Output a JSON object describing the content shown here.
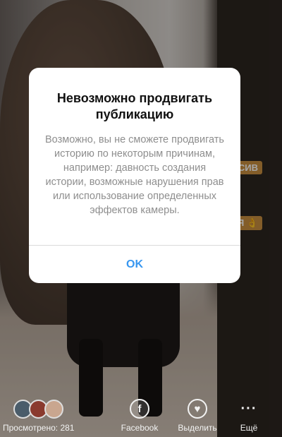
{
  "background": {
    "stickers": [
      "ТНСИВ",
      "ОСЯ 👌"
    ]
  },
  "dialog": {
    "title": "Невозможно продвигать публикацию",
    "message": "Возможно, вы не сможете продвигать историю по некоторым причинам, например: давность создания истории, возможные нарушения прав или использование определенных эффектов камеры.",
    "ok_label": "OK",
    "accent_color": "#3897f0"
  },
  "bottom_bar": {
    "viewers_label": "Просмотрено: 281",
    "actions": [
      {
        "label": "Facebook",
        "icon": "facebook-icon",
        "glyph": "f"
      },
      {
        "label": "Выделить",
        "icon": "highlight-heart-icon",
        "glyph": "♥"
      },
      {
        "label": "Ещё",
        "icon": "more-icon",
        "glyph": "···"
      }
    ]
  }
}
